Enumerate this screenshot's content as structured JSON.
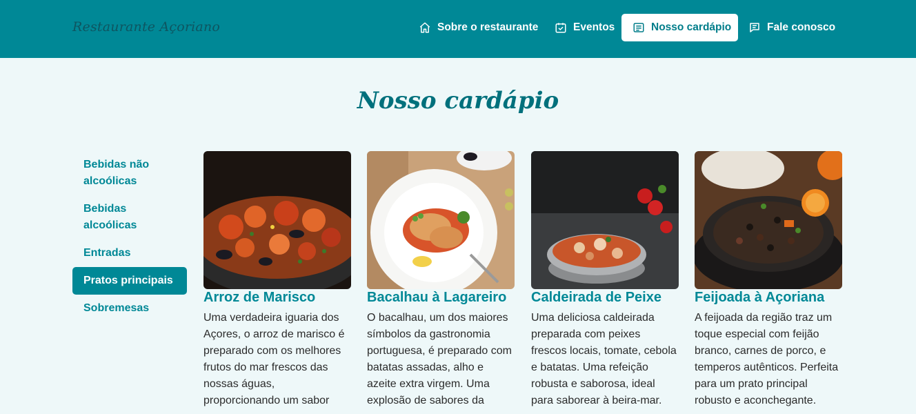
{
  "header": {
    "brand": "Restaurante Açoriano",
    "nav": [
      {
        "label": "Sobre o restaurante",
        "icon": "home-icon"
      },
      {
        "label": "Eventos",
        "icon": "calendar-check-icon"
      },
      {
        "label": "Nosso cardápio",
        "icon": "menu-list-icon",
        "active": true
      },
      {
        "label": "Fale conosco",
        "icon": "chat-icon"
      }
    ]
  },
  "main": {
    "title": "Nosso cardápio",
    "categories": [
      {
        "label": "Bebidas não alcoólicas"
      },
      {
        "label": "Bebidas alcoólicas"
      },
      {
        "label": "Entradas"
      },
      {
        "label": "Pratos principais",
        "active": true
      },
      {
        "label": "Sobremesas"
      }
    ],
    "dishes": [
      {
        "name": "Arroz de Marisco",
        "description": "Uma verdadeira iguaria dos Açores, o arroz de marisco é preparado com os melhores frutos do mar frescos das nossas águas, proporcionando um sabor"
      },
      {
        "name": "Bacalhau à Lagareiro",
        "description": "O bacalhau, um dos maiores símbolos da gastronomia portuguesa, é preparado com batatas assadas, alho e azeite extra virgem. Uma explosão de sabores da"
      },
      {
        "name": "Caldeirada de Peixe",
        "description": "Uma deliciosa caldeirada preparada com peixes frescos locais, tomate, cebola e batatas. Uma refeição robusta e saborosa, ideal para saborear à beira-mar."
      },
      {
        "name": "Feijoada à Açoriana",
        "description": "A feijoada da região traz um toque especial com feijão branco, carnes de porco, e temperos autênticos. Perfeita para um prato principal robusto e aconchegante."
      }
    ]
  },
  "colors": {
    "primary": "#008896",
    "background": "#eef8f9",
    "title": "#00707c"
  }
}
